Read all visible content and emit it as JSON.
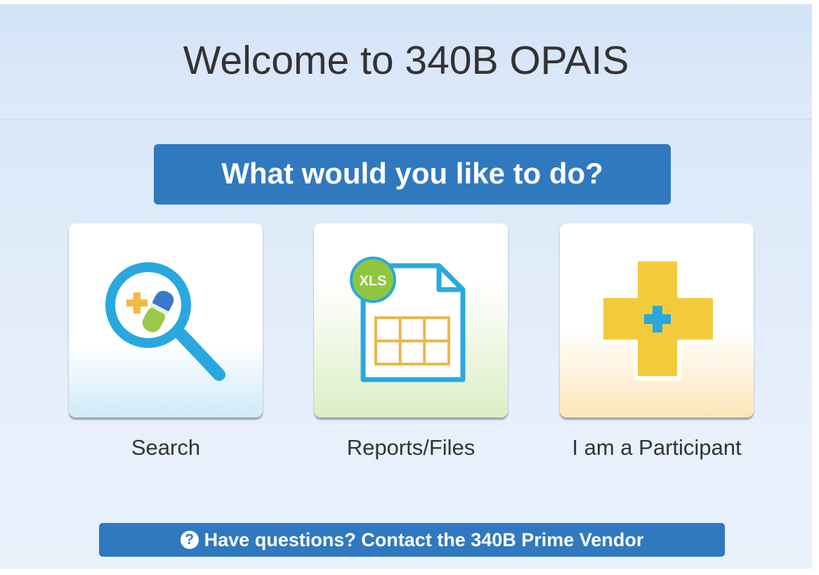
{
  "header": {
    "title": "Welcome to 340B OPAIS"
  },
  "prompt": {
    "text": "What would you like to do?"
  },
  "tiles": [
    {
      "label": "Search",
      "icon": "magnifier-pills-icon"
    },
    {
      "label": "Reports/Files",
      "icon": "xls-file-icon",
      "badge": "XLS"
    },
    {
      "label": "I am a Participant",
      "icon": "medical-cross-icon"
    }
  ],
  "contact": {
    "text": "Have questions? Contact the 340B Prime Vendor",
    "icon_glyph": "?"
  },
  "colors": {
    "banner": "#3079bf",
    "search_tile_accent": "#29a8df",
    "reports_badge": "#8ec63f",
    "participant_cross": "#f2cb3d"
  }
}
